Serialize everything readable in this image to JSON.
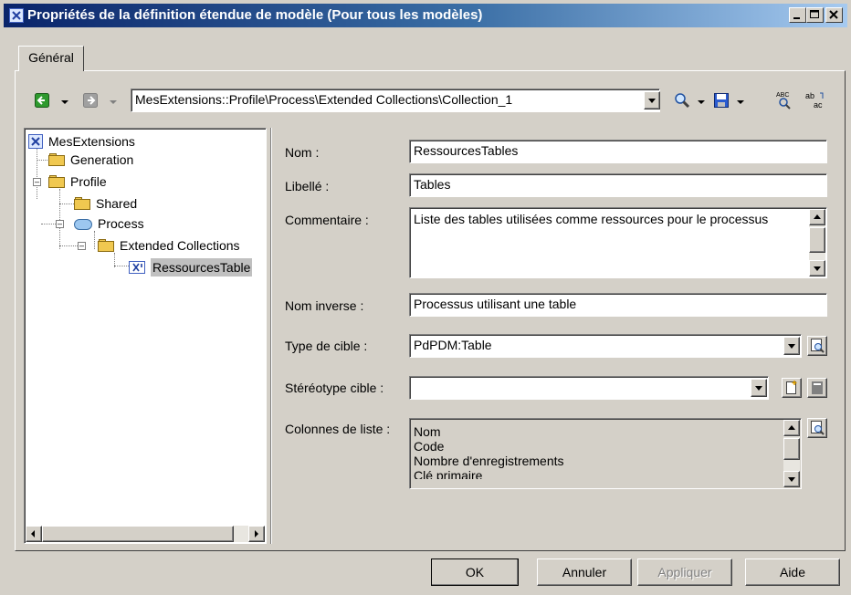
{
  "window": {
    "title": "Propriétés de la définition étendue de modèle (Pour tous les modèles)",
    "controls": [
      "minimize",
      "maximize",
      "close"
    ]
  },
  "tabs": [
    {
      "label": "Général",
      "active": true
    }
  ],
  "toolbar": {
    "path": "MesExtensions::Profile\\Process\\Extended Collections\\Collection_1",
    "icons": [
      "back-arrow-icon",
      "forward-arrow-icon",
      "find-icon",
      "save-icon",
      "spellcheck-icon",
      "text-format-icon"
    ]
  },
  "tree": {
    "root": "MesExtensions",
    "items": [
      "Generation",
      "Profile",
      "Shared",
      "Process",
      "Extended Collections",
      "RessourcesTable"
    ]
  },
  "form": {
    "nom_label": "Nom :",
    "nom_value": "RessourcesTables",
    "libelle_label": "Libellé :",
    "libelle_value": "Tables",
    "commentaire_label": "Commentaire :",
    "commentaire_value": "Liste des tables utilisées comme ressources pour le processus",
    "nom_inverse_label": "Nom inverse :",
    "nom_inverse_value": "Processus utilisant une table",
    "type_cible_label": "Type de cible :",
    "type_cible_value": "PdPDM:Table",
    "stereotype_label": "Stéréotype cible :",
    "stereotype_value": "",
    "colonnes_label": "Colonnes de liste :",
    "colonnes": [
      "Nom",
      "Code",
      "Nombre d'enregistrements",
      "Clé primaire"
    ]
  },
  "buttons": {
    "ok": "OK",
    "cancel": "Annuler",
    "apply": "Appliquer",
    "help": "Aide"
  }
}
